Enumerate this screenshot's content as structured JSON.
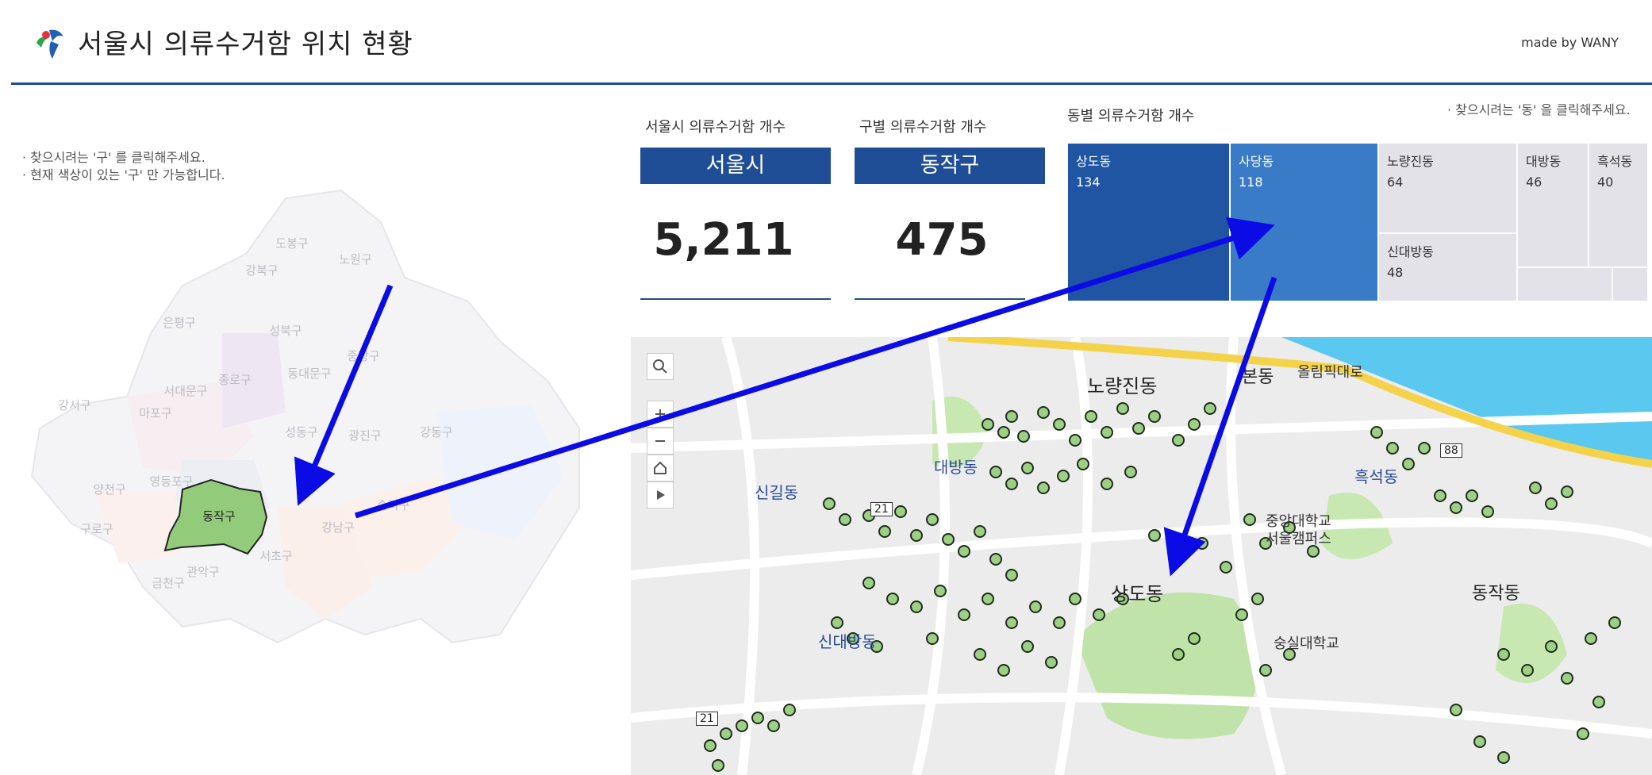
{
  "header": {
    "title": "서울시 의류수거함 위치 현황",
    "made_by": "made by WANY",
    "logo_icon": "seoul-logo-icon"
  },
  "seoul_panel": {
    "hints": [
      "· 찾으시려는 '구' 를 클릭해주세요.",
      "· 현재 색상이 있는 '구' 만 가능합니다."
    ],
    "districts": [
      "도봉구",
      "노원구",
      "강북구",
      "은평구",
      "성북구",
      "중랑구",
      "종로구",
      "동대문구",
      "서대문구",
      "마포구",
      "강서구",
      "광진구",
      "강동구",
      "성동구",
      "양천구",
      "영등포구",
      "송파구",
      "구로구",
      "동작구",
      "강남구",
      "서초구",
      "금천구",
      "관악구"
    ],
    "selected": "동작구",
    "selected_color": "#92cc7a"
  },
  "cards": [
    {
      "label": "서울시 의류수거함 개수",
      "pill": "서울시",
      "value": "5,211"
    },
    {
      "label": "구별 의류수거함 개수",
      "pill": "동작구",
      "value": "475"
    }
  ],
  "treemap": {
    "title": "동별 의류수거함 개수",
    "hint": "· 찾으시려는 '동' 을 클릭해주세요.",
    "cells": [
      {
        "name": "상도동",
        "value": "134"
      },
      {
        "name": "사당동",
        "value": "118"
      },
      {
        "name": "노량진동",
        "value": "64"
      },
      {
        "name": "대방동",
        "value": "46"
      },
      {
        "name": "흑석동",
        "value": "40"
      },
      {
        "name": "신대방동",
        "value": "48"
      }
    ]
  },
  "map": {
    "labels": {
      "noryangjin": "노량진동",
      "bondong": "본동",
      "daebang": "대방동",
      "heukseok": "흑석동",
      "singil": "신길동",
      "sangdo": "상도동",
      "singdaebang": "신대방동",
      "dongjak": "동작동",
      "cau": "중앙대학교\n서울캠퍼스",
      "ssu": "숭실대학교",
      "olympic": "올림픽대로",
      "road88": "88",
      "road21": "21",
      "road21b": "21"
    },
    "controls": [
      "search-icon",
      "zoom-in-icon",
      "zoom-out-icon",
      "home-icon",
      "play-icon"
    ],
    "marker_color": "#9ecf86"
  }
}
